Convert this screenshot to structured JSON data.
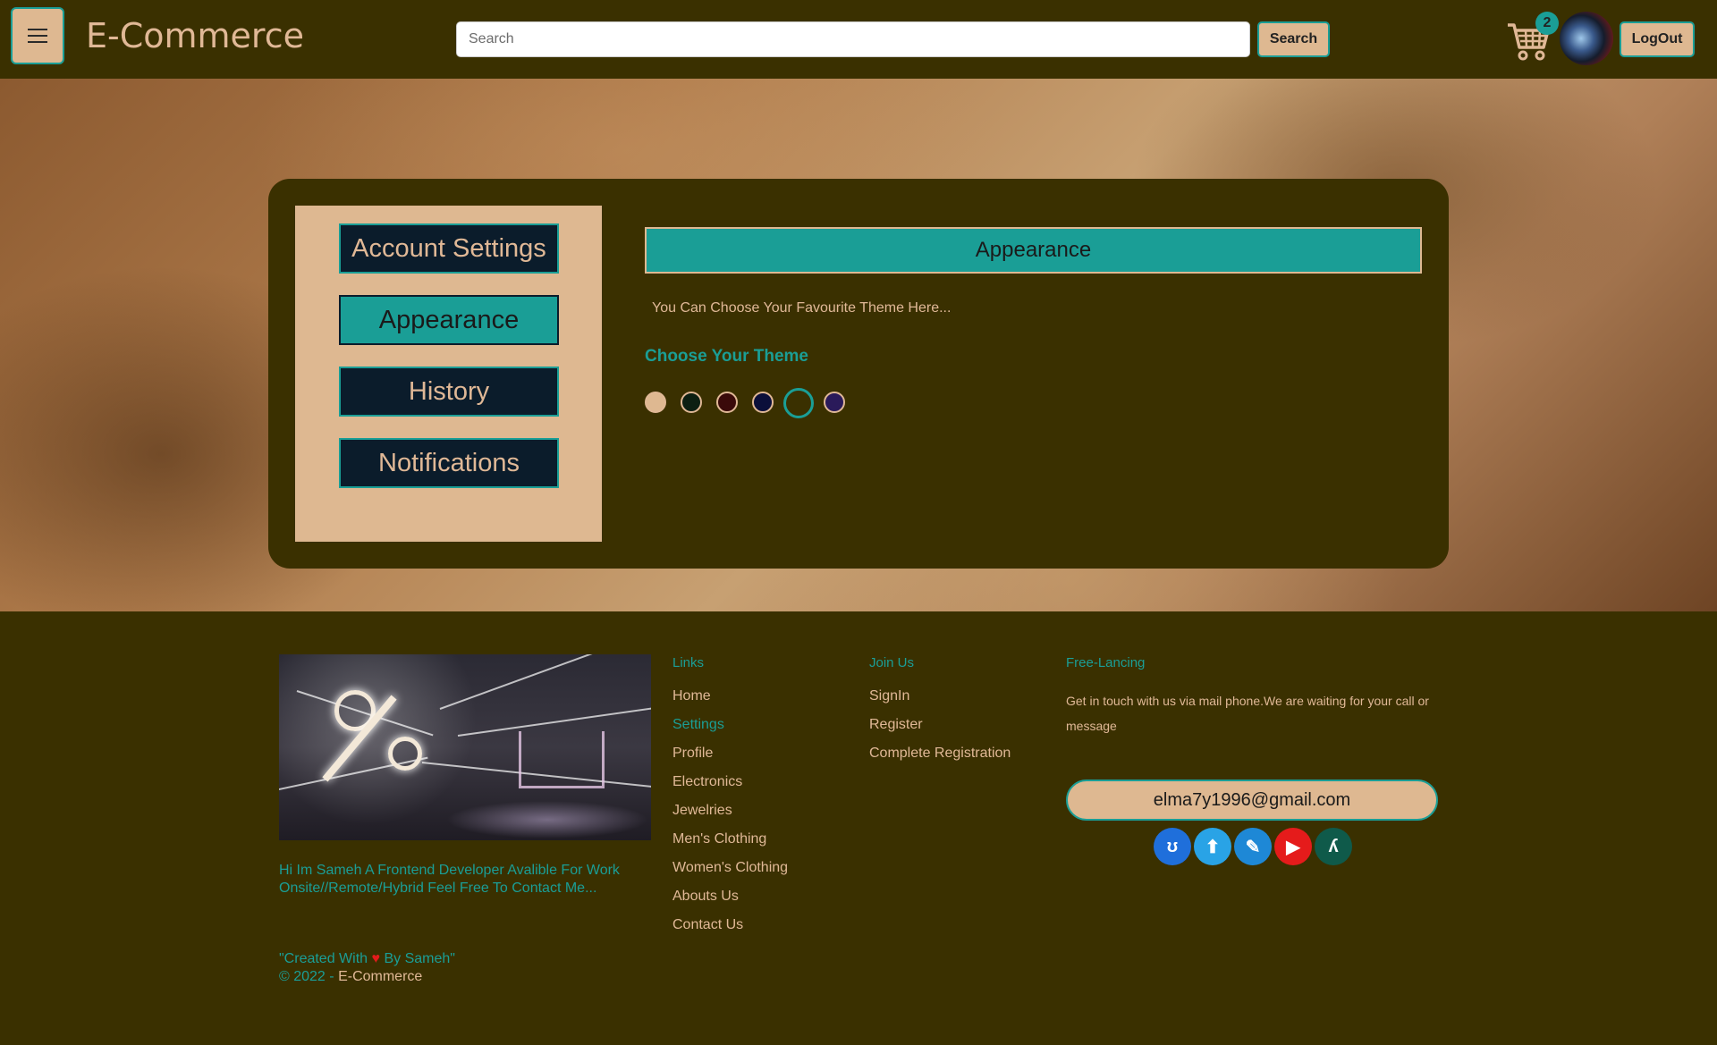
{
  "header": {
    "brand": "E-Commerce",
    "search_placeholder": "Search",
    "search_button": "Search",
    "cart_count": "2",
    "logout": "LogOut"
  },
  "settings": {
    "menu": [
      {
        "label": "Account Settings",
        "active": false
      },
      {
        "label": "Appearance",
        "active": true
      },
      {
        "label": "History",
        "active": false
      },
      {
        "label": "Notifications",
        "active": false
      }
    ],
    "section_title": "Appearance",
    "description": "You Can Choose Your Favourite Theme Here...",
    "theme_label": "Choose Your Theme",
    "themes": [
      "#deb891",
      "#0c1f12",
      "#3a0a0a",
      "#0b0f3a",
      "#1a9e96",
      "#2a1a5a"
    ],
    "selected_theme_index": 4
  },
  "footer": {
    "bio": "Hi Im Sameh A Frontend Developer Avalible For Work Onsite//Remote/Hybrid Feel Free To Contact Me...",
    "credit_prefix": "\"Created With",
    "credit_heart": "♥",
    "credit_suffix": "By Sameh\"",
    "copyright_prefix": "© 2022 -",
    "copyright_brand": "E-Commerce",
    "links_title": "Links",
    "links": [
      "Home",
      "Settings",
      "Profile",
      "Electronics",
      "Jewelries",
      "Men's Clothing",
      "Women's Clothing",
      "Abouts Us",
      "Contact Us"
    ],
    "active_link": "Settings",
    "join_title": "Join Us",
    "join_links": [
      "SignIn",
      "Register",
      "Complete Registration"
    ],
    "freelance_title": "Free-Lancing",
    "freelance_text": "Get in touch with us via mail phone.We are waiting for your call or message",
    "email": "elma7y1996@gmail.com",
    "social_icons": [
      {
        "name": "upwork-icon",
        "color": "#1f6fdb"
      },
      {
        "name": "freelancer-icon",
        "color": "#29a3e6"
      },
      {
        "name": "mostaql-icon",
        "color": "#1e88d6"
      },
      {
        "name": "youtube-icon",
        "color": "#e51b1b"
      },
      {
        "name": "khamsat-icon",
        "color": "#0f5a4a"
      }
    ]
  },
  "colors": {
    "accent": "#1a9e96",
    "sand": "#deb891",
    "dark_olive": "#3a3000",
    "navy": "#0b1c2b"
  }
}
